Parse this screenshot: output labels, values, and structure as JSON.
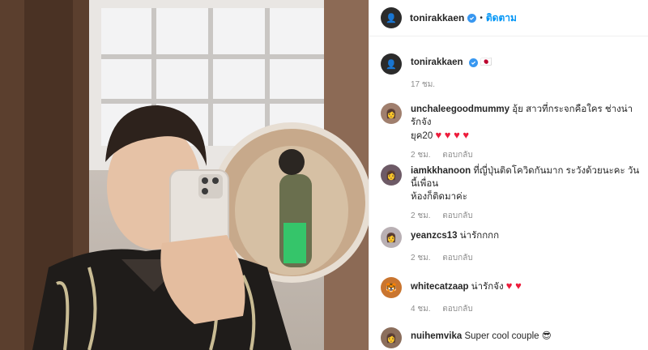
{
  "post": {
    "author": "tonirakkaen",
    "follow_label": "ติดตาม",
    "caption_emoji": "🇯🇵",
    "caption_time": "17 ชม."
  },
  "comments": [
    {
      "user": "unchaleegoodmummy",
      "text": "อุ้ย สาวที่กระจกคือใคร ช่างน่ารักจัง",
      "text2": "ยุค20",
      "hearts": "♥ ♥ ♥ ♥",
      "time": "2 ชม.",
      "reply": "ตอบกลับ"
    },
    {
      "user": "iamkkhanoon",
      "text": "ที่ญี่ปุ่นติดโควิดกันมาก ระวังด้วยนะคะ วันนี้เพื่อน",
      "text2": "ห้องก็ติดมาค่ะ",
      "time": "2 ชม.",
      "reply": "ตอบกลับ"
    },
    {
      "user": "yeanzcs13",
      "text": "น่ารักกกก",
      "time": "2 ชม.",
      "reply": "ตอบกลับ"
    },
    {
      "user": "whitecatzaap",
      "text": "น่ารักจัง",
      "hearts": "♥ ♥",
      "time": "4 ชม.",
      "reply": "ตอบกลับ"
    },
    {
      "user": "nuihemvika",
      "text": "Super cool couple",
      "emoji": "😎"
    }
  ],
  "colors": {
    "link": "#0095f6",
    "verified": "#3897f0",
    "heart": "#ed1c3b",
    "muted": "#8e8e8e"
  }
}
